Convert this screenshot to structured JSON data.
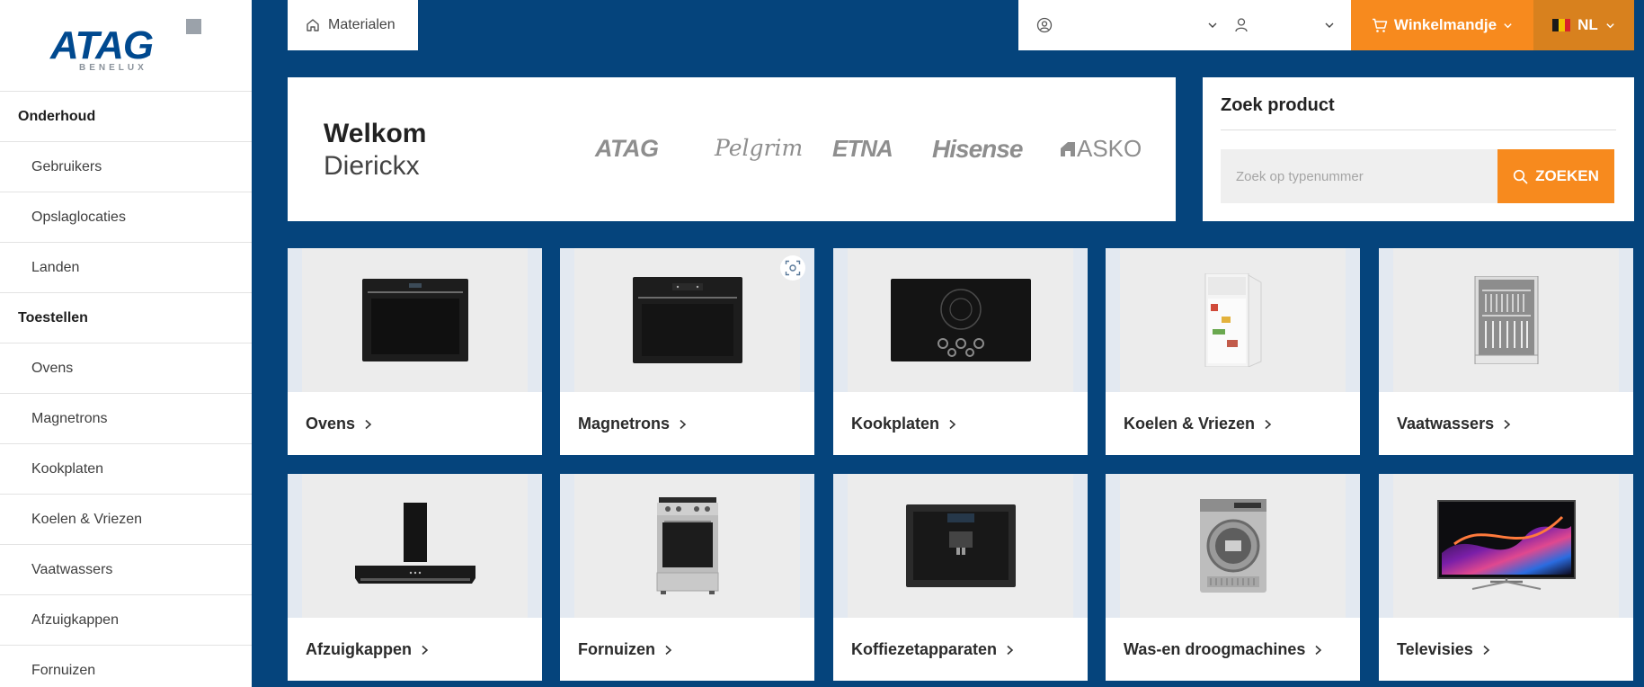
{
  "logo": {
    "brand": "ATAG",
    "sub": "BENELUX"
  },
  "sidebar": {
    "items": [
      {
        "label": "Onderhoud",
        "header": true
      },
      {
        "label": "Gebruikers"
      },
      {
        "label": "Opslaglocaties"
      },
      {
        "label": "Landen"
      },
      {
        "label": "Toestellen",
        "header": true
      },
      {
        "label": "Ovens"
      },
      {
        "label": "Magnetrons"
      },
      {
        "label": "Kookplaten"
      },
      {
        "label": "Koelen & Vriezen"
      },
      {
        "label": "Vaatwassers"
      },
      {
        "label": "Afzuigkappen"
      },
      {
        "label": "Fornuizen"
      }
    ]
  },
  "breadcrumb": {
    "label": "Materialen"
  },
  "header": {
    "cart_label": "Winkelmandje",
    "language": "NL",
    "flag_colors": [
      "#1a1a1a",
      "#f2c200",
      "#d8232a"
    ]
  },
  "welcome": {
    "title": "Welkom",
    "name": "Dierickx",
    "brands": [
      "ATAG",
      "Pelgrim",
      "ETNA",
      "Hisense",
      "ASKO"
    ]
  },
  "search": {
    "title": "Zoek product",
    "placeholder": "Zoek op typenummer",
    "button": "ZOEKEN"
  },
  "categories": [
    {
      "label": "Ovens",
      "icon": "oven-image"
    },
    {
      "label": "Magnetrons",
      "icon": "microwave-image"
    },
    {
      "label": "Kookplaten",
      "icon": "hob-image"
    },
    {
      "label": "Koelen & Vriezen",
      "icon": "fridge-image"
    },
    {
      "label": "Vaatwassers",
      "icon": "dishwasher-image"
    },
    {
      "label": "Afzuigkappen",
      "icon": "hood-image"
    },
    {
      "label": "Fornuizen",
      "icon": "cooker-image"
    },
    {
      "label": "Koffiezetapparaten",
      "icon": "coffee-machine-image"
    },
    {
      "label": "Was-en droogmachines",
      "icon": "dryer-image"
    },
    {
      "label": "Televisies",
      "icon": "television-image"
    }
  ],
  "colors": {
    "primary": "#05447c",
    "accent": "#f78a1e",
    "accent_dark": "#d8811e"
  }
}
